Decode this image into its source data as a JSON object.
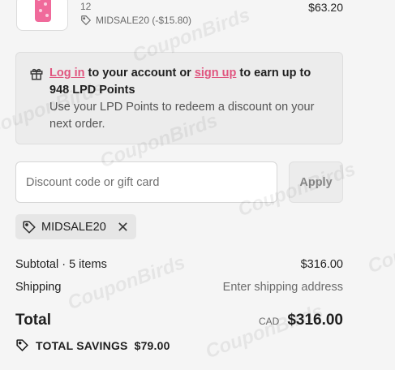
{
  "product": {
    "variant": "12",
    "discount": "MIDSALE20 (-$15.80)",
    "price": "$63.20"
  },
  "points": {
    "login_link": "Log in",
    "mid_text": " to your account or ",
    "signup_link": "sign up",
    "earn_text": " to earn up to 948 LPD Points",
    "subtext": "Use your LPD Points to redeem a discount on your next order."
  },
  "discount": {
    "placeholder": "Discount code or gift card",
    "apply_label": "Apply",
    "applied_code": "MIDSALE20"
  },
  "summary": {
    "subtotal_label": "Subtotal · 5 items",
    "subtotal_value": "$316.00",
    "shipping_label": "Shipping",
    "shipping_value": "Enter shipping address",
    "total_label": "Total",
    "currency": "CAD",
    "total_value": "$316.00",
    "savings_label": "TOTAL SAVINGS",
    "savings_value": "$79.00"
  },
  "watermark": "CouponBirds",
  "icons": [
    "tag-icon",
    "gift-icon",
    "close-icon"
  ],
  "colors": {
    "link": "#e0557f",
    "background": "#f5f5f5",
    "panel": "#ececec"
  }
}
